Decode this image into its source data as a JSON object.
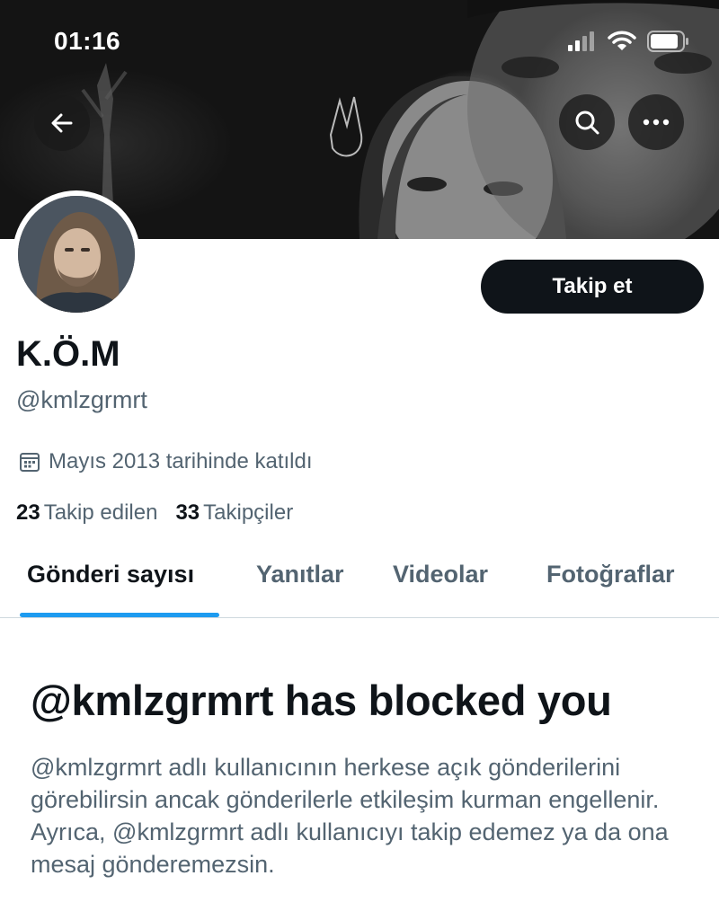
{
  "status_bar": {
    "time": "01:16"
  },
  "header": {
    "back_icon": "arrow-left-icon",
    "search_icon": "search-icon",
    "more_icon": "more-horizontal-icon"
  },
  "profile": {
    "follow_label": "Takip et",
    "display_name": "K.Ö.M",
    "handle": "@kmlzgrmrt",
    "joined_text": "Mayıs 2013 tarihinde katıldı",
    "following_count": "23",
    "following_label": "Takip edilen",
    "followers_count": "33",
    "followers_label": "Takipçiler"
  },
  "tabs": [
    {
      "label": "Gönderi sayısı",
      "active": true
    },
    {
      "label": "Yanıtlar",
      "active": false
    },
    {
      "label": "Videolar",
      "active": false
    },
    {
      "label": "Fotoğraflar",
      "active": false
    }
  ],
  "blocked": {
    "title": "@kmlzgrmrt has blocked you",
    "body": "@kmlzgrmrt adlı kullanıcının herkese açık gönderilerini görebilirsin ancak gönderilerle etkileşim kurman engellenir. Ayrıca, @kmlzgrmrt adlı kullanıcıyı takip edemez ya da ona mesaj gönderemezsin."
  },
  "colors": {
    "accent": "#1d9bf0",
    "text_primary": "#0f1419",
    "text_secondary": "#536471",
    "button_dark": "#0f1419"
  }
}
